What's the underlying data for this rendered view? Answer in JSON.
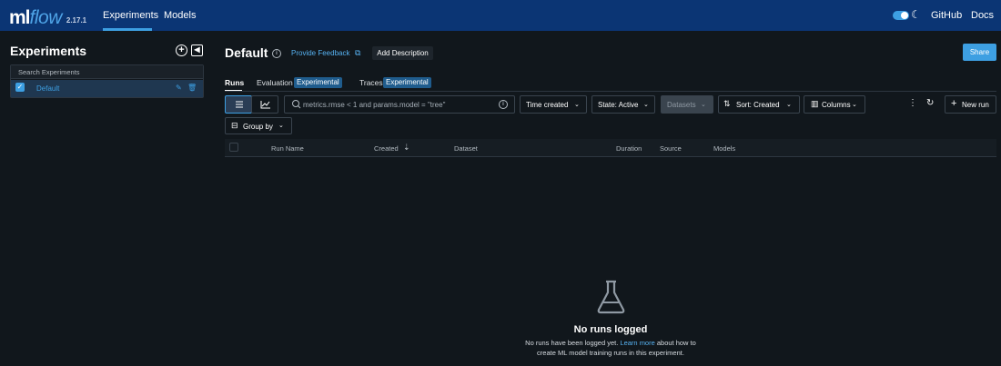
{
  "app": {
    "logo_main": "ml",
    "logo_flow": "flow",
    "version": "2.17.1"
  },
  "topnav": {
    "experiments": "Experiments",
    "models": "Models",
    "github": "GitHub",
    "docs": "Docs",
    "dark_mode": true
  },
  "sidebar": {
    "title": "Experiments",
    "search_placeholder": "Search Experiments",
    "experiments": [
      {
        "name": "Default",
        "selected": true
      }
    ]
  },
  "header": {
    "title": "Default",
    "provide_feedback": "Provide Feedback",
    "add_description": "Add Description",
    "share": "Share"
  },
  "tabs": [
    {
      "label": "Runs",
      "active": true
    },
    {
      "label": "Evaluation",
      "badge": "Experimental"
    },
    {
      "label": "Traces",
      "badge": "Experimental"
    }
  ],
  "toolbar": {
    "search_placeholder": "metrics.rmse < 1 and params.model = \"tree\"",
    "time_created": "Time created",
    "state": "State: Active",
    "datasets": "Datasets",
    "sort": "Sort: Created",
    "columns": "Columns",
    "new_run": "New run",
    "group_by": "Group by"
  },
  "table": {
    "columns": [
      "Run Name",
      "Created",
      "Dataset",
      "Duration",
      "Source",
      "Models"
    ]
  },
  "empty_state": {
    "title": "No runs logged",
    "desc_before": "No runs have been logged yet. ",
    "learn_more": "Learn more",
    "desc_after_line1": " about how to",
    "desc_line2": "create ML model training runs in this experiment."
  },
  "colors": {
    "nav_bg": "#0b3574",
    "accent": "#3d9fe2",
    "page_bg": "#11171c"
  }
}
